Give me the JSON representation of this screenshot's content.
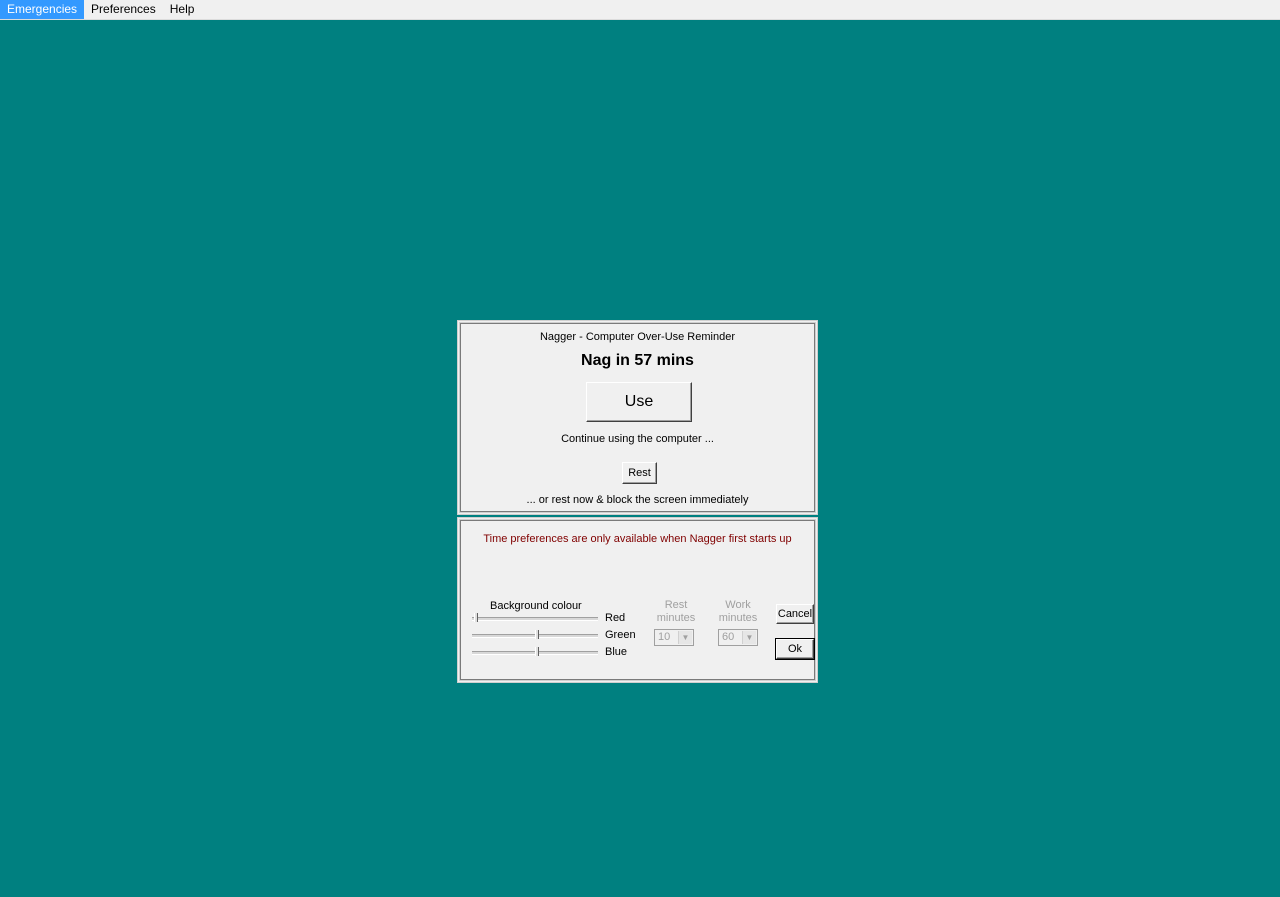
{
  "menu": {
    "items": [
      {
        "label": "Emergencies",
        "active": true
      },
      {
        "label": "Preferences"
      },
      {
        "label": "Help"
      }
    ]
  },
  "main": {
    "window_title": "Nagger - Computer Over-Use Reminder",
    "countdown": "Nag in 57 mins",
    "use_button": "Use",
    "use_caption": "Continue using the computer ...",
    "rest_button": "Rest",
    "rest_caption": "... or rest now & block the screen immediately"
  },
  "prefs": {
    "notice": "Time preferences are only available when Nagger first starts up",
    "background_label": "Background colour",
    "sliders": [
      {
        "label": "Red",
        "value": 0.0
      },
      {
        "label": "Green",
        "value": 0.5
      },
      {
        "label": "Blue",
        "value": 0.5
      }
    ],
    "rest_minutes": {
      "label_line1": "Rest",
      "label_line2": "minutes",
      "value": "10"
    },
    "work_minutes": {
      "label_line1": "Work",
      "label_line2": "minutes",
      "value": "60"
    },
    "cancel_button": "Cancel",
    "ok_button": "Ok"
  },
  "colors": {
    "desktop": "#008080",
    "panel": "#f0f0f0",
    "notice_text": "#800000",
    "menu_active": "#3399ff"
  }
}
